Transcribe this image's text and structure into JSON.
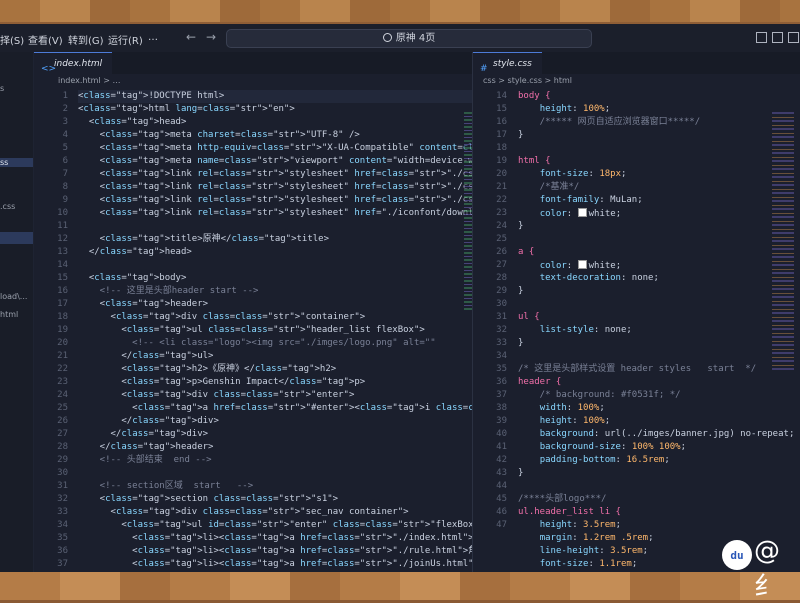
{
  "titlebar": {
    "menus": [
      "择(S)",
      "查看(V)",
      "转到(G)",
      "运行(R)",
      "…"
    ],
    "search_text": "原神 4页"
  },
  "activity": {
    "items": [
      "s",
      "ss",
      ".css",
      "load\\...",
      "html"
    ]
  },
  "left_editor": {
    "tab": "index.html",
    "breadcrumb": "index.html > …",
    "line_numbers": [
      "1",
      "2",
      "3",
      "4",
      "5",
      "6",
      "7",
      "8",
      "9",
      "10",
      "11",
      "12",
      "13",
      "14",
      "15",
      "16",
      "17",
      "18",
      "19",
      "20",
      "21",
      "22",
      "23",
      "24",
      "25",
      "26",
      "27",
      "28",
      "29",
      "30",
      "31",
      "32",
      "33",
      "34",
      "35",
      "36",
      "37",
      "38",
      "39"
    ],
    "lines": [
      "<!DOCTYPE html>",
      "<html lang=\"en\">",
      "  <head>",
      "    <meta charset=\"UTF-8\" />",
      "    <meta http-equiv=\"X-UA-Compatible\" content=\"IE=edge\" />",
      "    <meta name=\"viewport\" content=\"width=device-width, initial-scal",
      "    <link rel=\"stylesheet\" href=\"./css/style.css\" />",
      "    <link rel=\"stylesheet\" href=\"./css/commonStyle.css\" />",
      "    <link rel=\"stylesheet\" href=\"./css/font.css\" />",
      "    <link rel=\"stylesheet\" href=\"./iconfont/download/iconfont01/ico",
      "",
      "    <title>原神</title>",
      "  </head>",
      "",
      "  <body>",
      "    <!-- 这里是头部header start -->",
      "    <header>",
      "      <div class=\"container\">",
      "        <ul class=\"header_list flexBox\">",
      "          <!-- <li class=\"logo\"><img src=\"./imges/logo.png\" alt=\"\"",
      "        </ul>",
      "        <h2>《原神》</h2>",
      "        <p>Genshin Impact</p>",
      "        <div class=\"enter\">",
      "          <a href=\"#enter\"><i class=\"iconfont icon-jiantouxia\"></i>",
      "        </div>",
      "      </div>",
      "    </header>",
      "    <!-- 头部结束  end -->",
      "",
      "    <!-- section区域  start   -->",
      "    <section class=\"s1\">",
      "      <div class=\"sec_nav container\">",
      "        <ul id=\"enter\" class=\"flexBox flexCenter\">",
      "          <li><a href=\"./index.html\">首页</a></li>",
      "          <li><a href=\"./rule.html\">角色介绍</a></li>",
      "          <li><a href=\"./joinUs.html\">加入我们</a></li>"
    ]
  },
  "right_editor": {
    "tab": "style.css",
    "breadcrumb": [
      "css",
      "style.css",
      "html"
    ],
    "line_numbers": [
      "14",
      "15",
      "16",
      "17",
      "18",
      "19",
      "20",
      "21",
      "22",
      "23",
      "24",
      "25",
      "26",
      "27",
      "28",
      "29",
      "30",
      "31",
      "32",
      "33",
      "34",
      "35",
      "36",
      "37",
      "38",
      "39",
      "40",
      "41",
      "42",
      "43",
      "44",
      "45",
      "46",
      "47"
    ],
    "lines": [
      "body {",
      "    height: 100%;",
      "    /***** 网页自适应浏览器窗口*****/",
      "}",
      "",
      "html {",
      "    font-size: 18px;",
      "    /*基准*/",
      "    font-family: MuLan;",
      "    color: white;",
      "}",
      "",
      "a {",
      "    color: white;",
      "    text-decoration: none;",
      "}",
      "",
      "ul {",
      "    list-style: none;",
      "}",
      "",
      "/* 这里是头部样式设置 header styles   start  */",
      "header {",
      "    /* background: #f0531f; */",
      "    width: 100%;",
      "    height: 100%;",
      "    background: url(../imges/banner.jpg) no-repeat;",
      "    background-size: 100% 100%;",
      "    padding-bottom: 16.5rem;",
      "}",
      "",
      "/****头部logo***/",
      "ul.header_list li {",
      "    height: 3.5rem;",
      "    margin: 1.2rem .5rem;",
      "    line-height: 3.5rem;",
      "    font-size: 1.1rem;"
    ],
    "swatch_lines": [
      9,
      13
    ],
    "colors": {
      "swatch_white": "#ffffff"
    }
  },
  "watermark": {
    "badge": "du",
    "text": "@纟"
  }
}
